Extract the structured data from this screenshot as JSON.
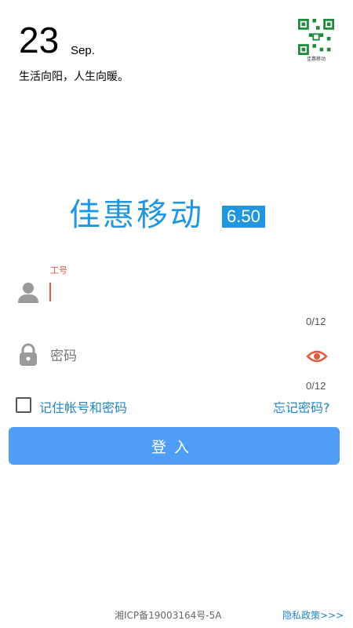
{
  "header": {
    "day": "23",
    "month": "Sep.",
    "motto": "生活向阳，人生向暖。",
    "qr_caption": "佳惠移动"
  },
  "brand": {
    "name": "佳惠移动",
    "version": "6.50"
  },
  "form": {
    "employee_label": "工号",
    "employee_value": "",
    "employee_counter": "0/12",
    "password_placeholder": "密码",
    "password_counter": "0/12",
    "remember_label": "记住帐号和密码",
    "remember_checked": false,
    "forgot_label": "忘记密码?",
    "login_label": "登入"
  },
  "footer": {
    "icp": "湘ICP备19003164号-5A",
    "privacy": "隐私政策>>>"
  },
  "colors": {
    "brand_blue": "#1f96de",
    "button_blue": "#4f9df4",
    "link_blue": "#1f86c9",
    "accent_red": "#e2583e"
  }
}
